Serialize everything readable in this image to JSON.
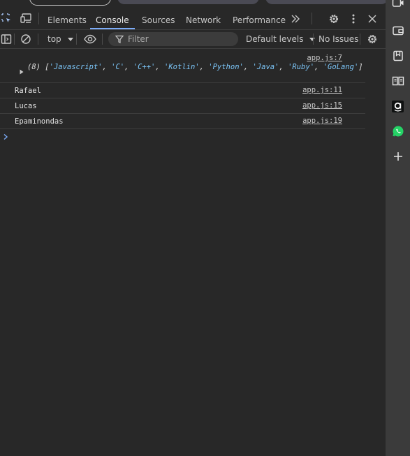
{
  "tabs": {
    "elements": "Elements",
    "console": "Console",
    "sources": "Sources",
    "network": "Network",
    "performance": "Performance"
  },
  "toolbar": {
    "context": "top",
    "filter_placeholder": "Filter",
    "levels": "Default levels",
    "issues": "No Issues"
  },
  "console": {
    "array_log": {
      "count": "(8)",
      "open": "[",
      "items": [
        "'Javascript'",
        "'C'",
        "'C++'",
        "'Kotlin'",
        "'Python'",
        "'Java'",
        "'Ruby'",
        "'GoLang'"
      ],
      "close": "]",
      "source": "app.js:7"
    },
    "logs": [
      {
        "text": "Rafael",
        "source": "app.js:11"
      },
      {
        "text": "Lucas",
        "source": "app.js:15"
      },
      {
        "text": "Epaminondas",
        "source": "app.js:19"
      }
    ]
  },
  "colors": {
    "background": "#282828",
    "accent": "#7cacf8",
    "string": "#7cc6f9",
    "whatsapp": "#25d366"
  },
  "icons": {
    "inspect": "inspect-element-icon",
    "device": "device-toolbar-icon",
    "more_tabs": "chevron-double-right-icon",
    "settings": "gear-icon",
    "menu": "kebab-menu-icon",
    "close": "close-icon",
    "sidebar": "sidebar-toggle-icon",
    "clear": "clear-console-icon",
    "eye": "eye-icon",
    "filter": "filter-funnel-icon",
    "expand": "expand-triangle-icon",
    "prompt": "prompt-chevron-icon",
    "side_video": "video-icon",
    "side_wallet": "wallet-icon",
    "side_bookmark": "bookmark-icon",
    "side_reader": "reading-list-icon",
    "side_amazon": "amazon-icon",
    "side_whatsapp": "whatsapp-icon",
    "side_add": "plus-icon"
  }
}
